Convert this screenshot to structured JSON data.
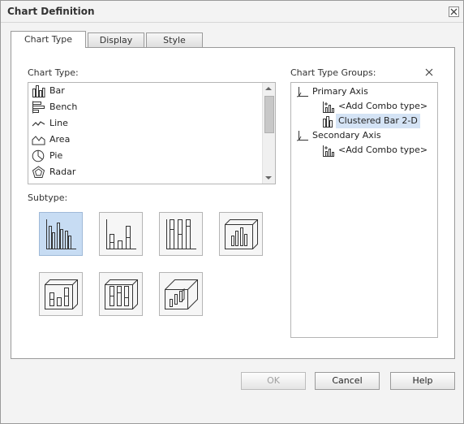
{
  "dialog": {
    "title": "Chart Definition"
  },
  "tabs": [
    {
      "label": "Chart Type",
      "active": true
    },
    {
      "label": "Display",
      "active": false
    },
    {
      "label": "Style",
      "active": false
    }
  ],
  "chart_type": {
    "label": "Chart Type:",
    "items": [
      {
        "label": "Bar",
        "icon": "bar-chart-icon"
      },
      {
        "label": "Bench",
        "icon": "bench-chart-icon"
      },
      {
        "label": "Line",
        "icon": "line-chart-icon"
      },
      {
        "label": "Area",
        "icon": "area-chart-icon"
      },
      {
        "label": "Pie",
        "icon": "pie-chart-icon"
      },
      {
        "label": "Radar",
        "icon": "radar-chart-icon"
      }
    ]
  },
  "subtype": {
    "label": "Subtype:",
    "items": [
      {
        "icon": "clustered-bar-2d-icon",
        "selected": true
      },
      {
        "icon": "stacked-bar-2d-icon",
        "selected": false
      },
      {
        "icon": "percent-bar-2d-icon",
        "selected": false
      },
      {
        "icon": "clustered-bar-3d-icon",
        "selected": false
      },
      {
        "icon": "stacked-bar-3d-icon",
        "selected": false
      },
      {
        "icon": "percent-bar-3d-icon",
        "selected": false
      },
      {
        "icon": "bar-3d-depth-icon",
        "selected": false
      }
    ]
  },
  "groups": {
    "label": "Chart Type Groups:",
    "tree": [
      {
        "label": "Primary Axis",
        "icon": "axis-icon",
        "level": 0
      },
      {
        "label": "<Add Combo type>",
        "icon": "combo-chart-icon",
        "level": 1
      },
      {
        "label": "Clustered Bar 2-D",
        "icon": "bar-chart-icon",
        "level": 1,
        "selected": true
      },
      {
        "label": "Secondary Axis",
        "icon": "axis-icon",
        "level": 0
      },
      {
        "label": "<Add Combo type>",
        "icon": "combo-chart-icon",
        "level": 1
      }
    ]
  },
  "buttons": {
    "ok": "OK",
    "cancel": "Cancel",
    "help": "Help"
  },
  "colors": {
    "selection": "#c7dcf3",
    "tree_selection": "#d4e3f5"
  }
}
